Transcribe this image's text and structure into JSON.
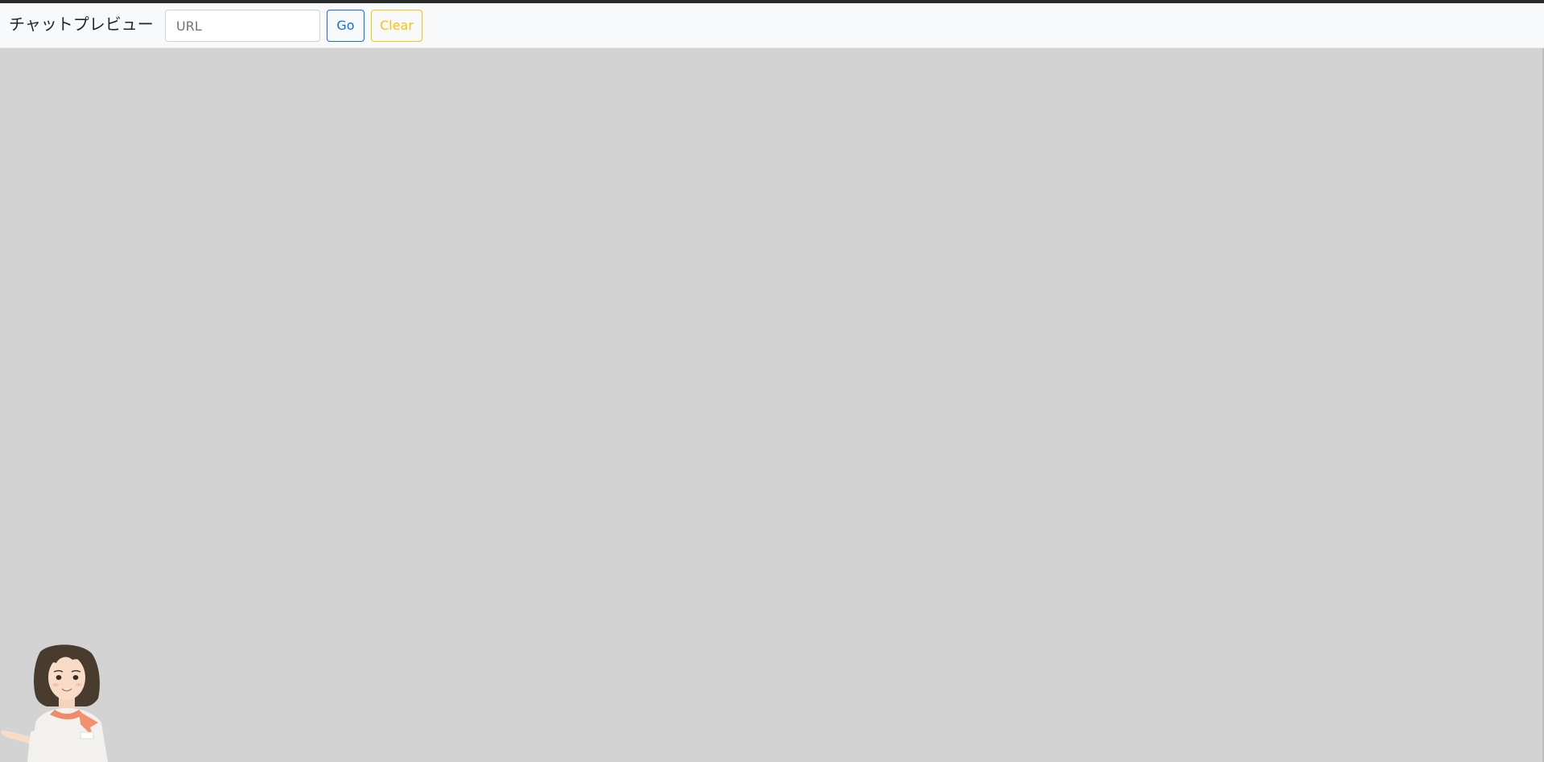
{
  "header": {
    "title": "チャットプレビュー"
  },
  "url_input": {
    "value": "",
    "placeholder": "URL"
  },
  "buttons": {
    "go_label": "Go",
    "clear_label": "Clear"
  },
  "colors": {
    "go": "#0d6efd",
    "clear": "#ffc107",
    "preview_background": "#d3d3d3",
    "navbar_background": "#f8f9fa"
  },
  "assistant_avatar": {
    "icon": "assistant-character"
  }
}
